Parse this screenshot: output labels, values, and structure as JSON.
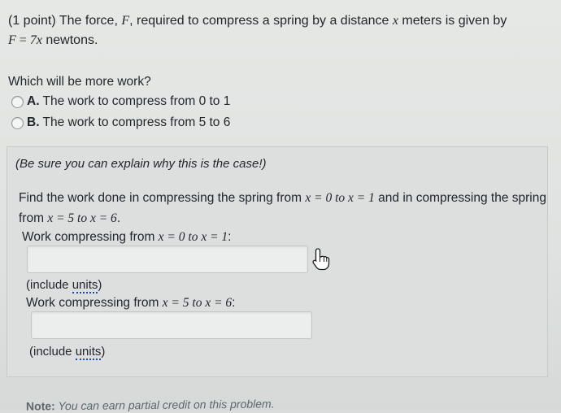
{
  "problem": {
    "statement_prefix": "(1 point) The force, ",
    "force_symbol": "F",
    "statement_mid": ", required to compress a spring by a distance ",
    "distance_symbol": "x",
    "statement_suffix": " meters is given by",
    "equation_lhs": "F",
    "equals": " = ",
    "equation_rhs": "7x",
    "equation_unit": " newtons.",
    "question": "Which will be more work?",
    "choices": [
      {
        "letter": "A.",
        "text": " The work to compress from 0 to 1"
      },
      {
        "letter": "B.",
        "text": " The work to compress from 5 to 6"
      }
    ]
  },
  "panel": {
    "hint": "(Be sure you can explain why this is the case!)",
    "find_prefix": "Find the work done in compressing the spring from ",
    "find_range1": "x = 0 to x = 1",
    "find_mid1": " and in compressing the spring from ",
    "find_range2": "x = 5 to x = 6",
    "find_end": ".",
    "label1_prefix": "Work compressing from ",
    "label1_range": "x = 0 to x = 1",
    "label1_suffix": ":",
    "label2_prefix": "Work compressing from ",
    "label2_range": "x = 5 to x = 6",
    "label2_suffix": ":",
    "include_prefix": "(include ",
    "units_link": "units",
    "include_suffix": ")",
    "answer1_value": "",
    "answer2_value": ""
  },
  "footer": {
    "note_label": "Note:",
    "note_text": " You can earn partial credit on this problem."
  },
  "icons": {
    "cursor": "hand-pointer-icon",
    "radio": "radio-unselected-icon"
  }
}
